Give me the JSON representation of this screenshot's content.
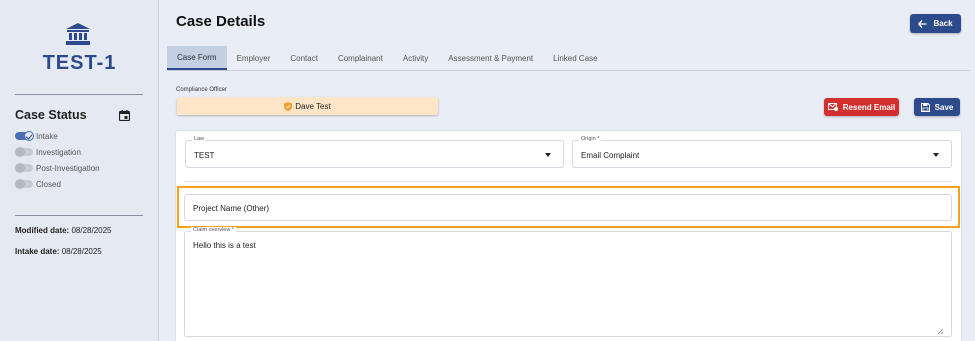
{
  "sidebar": {
    "case_icon": "bank-building-icon",
    "case_id": "TEST-1",
    "status_title": "Case Status",
    "calendar_icon": "calendar-icon",
    "statuses": [
      {
        "label": "Intake",
        "on": true
      },
      {
        "label": "Investigation",
        "on": false
      },
      {
        "label": "Post-Investigation",
        "on": false
      },
      {
        "label": "Closed",
        "on": false
      }
    ],
    "modified_label": "Modified date:",
    "modified_value": "08/28/2025",
    "intake_label": "Intake date:",
    "intake_value": "08/28/2025"
  },
  "header": {
    "title": "Case Details",
    "back_label": "Back",
    "back_icon": "arrow-left-icon"
  },
  "tabs": [
    {
      "label": "Case Form",
      "active": true
    },
    {
      "label": "Employer",
      "active": false
    },
    {
      "label": "Contact",
      "active": false
    },
    {
      "label": "Complainant",
      "active": false
    },
    {
      "label": "Activity",
      "active": false
    },
    {
      "label": "Assessment & Payment",
      "active": false
    },
    {
      "label": "Linked Case",
      "active": false
    }
  ],
  "officer": {
    "label": "Compliance Officer",
    "name": "Dave Test",
    "icon": "shield-icon"
  },
  "actions": {
    "resend_label": "Resend Email",
    "resend_icon": "email-resend-icon",
    "save_label": "Save",
    "save_icon": "floppy-disk-icon"
  },
  "form": {
    "law_label": "Law",
    "law_value": "TEST",
    "origin_label": "Origin *",
    "origin_value": "Email Complaint",
    "project_name_placeholder": "Project Name (Other)",
    "claim_label": "Claim overview *",
    "claim_value": "Hello this is a test"
  },
  "colors": {
    "primary": "#2d4b8c",
    "danger": "#d32f2f",
    "officer_bg": "#fde5c8",
    "highlight": "#f5a21b"
  }
}
